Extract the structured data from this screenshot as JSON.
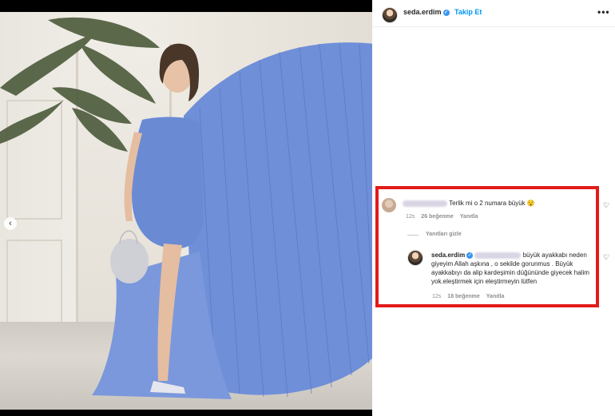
{
  "post": {
    "username": "seda.erdim",
    "follow_label": "Takip Et",
    "more_label": "•••",
    "prev_label": "‹",
    "verified_glyph": "✓"
  },
  "comments": [
    {
      "text": "Terlik mi o 2 numara büyük 😯",
      "time": "12s",
      "likes": "26 beğenme",
      "reply": "Yanıtla"
    }
  ],
  "replies_toggle": "Yanıtları gizle",
  "reply": {
    "username": "seda.erdim",
    "text": "büyük ayakkabı neden giyeyim Allah aşkına , o sekilde gorunmus . Büyük ayakkabıyı da alip kardeşimin düğününde giyecek halim yok.eleştirmek için eleştirmeyin lütfen",
    "time": "12s",
    "likes": "18 beğenme",
    "reply": "Yanıtla"
  },
  "icons": {
    "heart": "♡",
    "verified": "verified-badge-icon",
    "more": "more-options-icon",
    "prev": "chevron-left-icon"
  },
  "colors": {
    "accent_blue": "#0095f6",
    "highlight_red": "#e21b1b",
    "dress_blue": "#6f8fd8"
  }
}
